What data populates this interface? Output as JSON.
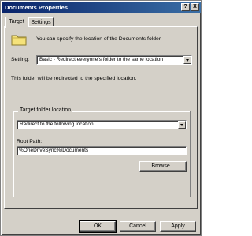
{
  "window": {
    "title": "Documents Properties",
    "help_btn": "?",
    "close_btn": "X"
  },
  "tabs": [
    {
      "label": "Target",
      "active": true
    },
    {
      "label": "Settings",
      "active": false
    }
  ],
  "target": {
    "intro_text": "You can specify the location of the Documents folder.",
    "setting_label": "Setting:",
    "setting_value": "Basic - Redirect everyone's folder to the same location",
    "info_text": "This folder will be redirected to the specified location.",
    "group_label": "Target folder location",
    "location_value": "Redirect to the following location",
    "root_path_label": "Root Path:",
    "root_path_value": "%OneDriveSync%\\Documents",
    "browse_label": "Browse..."
  },
  "footer": {
    "ok_label": "OK",
    "cancel_label": "Cancel",
    "apply_label": "Apply"
  }
}
